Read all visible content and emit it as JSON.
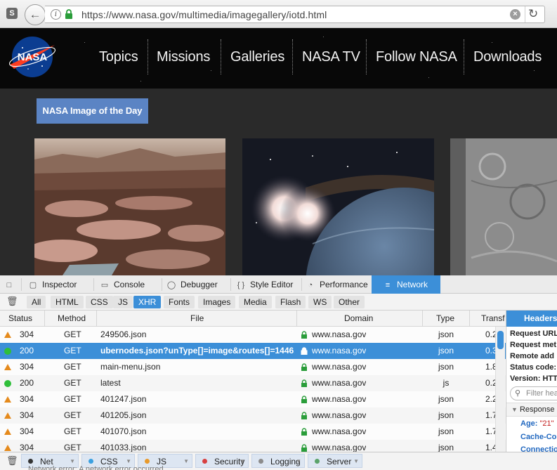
{
  "browser": {
    "ext_icon": "S",
    "url": "https://www.nasa.gov/multimedia/imagegallery/iotd.html"
  },
  "site": {
    "logo_text": "NASA",
    "nav": [
      "Topics",
      "Missions",
      "Galleries",
      "NASA TV",
      "Follow NASA",
      "Downloads"
    ],
    "badge": "NASA Image of the Day"
  },
  "devtools": {
    "tabs": [
      {
        "label": "Inspector",
        "icon": "inspector-icon"
      },
      {
        "label": "Console",
        "icon": "console-icon"
      },
      {
        "label": "Debugger",
        "icon": "debugger-icon"
      },
      {
        "label": "Style Editor",
        "icon": "style-editor-icon"
      },
      {
        "label": "Performance",
        "icon": "performance-icon"
      },
      {
        "label": "Network",
        "icon": "network-icon",
        "active": true
      }
    ],
    "filters": [
      "All",
      "HTML",
      "CSS",
      "JS",
      "XHR",
      "Fonts",
      "Images",
      "Media",
      "Flash",
      "WS",
      "Other"
    ],
    "active_filter": "XHR",
    "columns": [
      "Status",
      "Method",
      "File",
      "Domain",
      "Type",
      "Transf"
    ],
    "rows": [
      {
        "status": "304",
        "kind": "warn",
        "method": "GET",
        "file": "249506.json",
        "domain": "www.nasa.gov",
        "type": "json",
        "transf": "0.2"
      },
      {
        "status": "200",
        "kind": "ok",
        "method": "GET",
        "file": "ubernodes.json?unType[]=image&routes[]=1446...",
        "domain": "www.nasa.gov",
        "type": "json",
        "transf": "0.3",
        "selected": true
      },
      {
        "status": "304",
        "kind": "warn",
        "method": "GET",
        "file": "main-menu.json",
        "domain": "www.nasa.gov",
        "type": "json",
        "transf": "1.8"
      },
      {
        "status": "200",
        "kind": "ok",
        "method": "GET",
        "file": "latest",
        "domain": "www.nasa.gov",
        "type": "js",
        "transf": "0.2"
      },
      {
        "status": "304",
        "kind": "warn",
        "method": "GET",
        "file": "401247.json",
        "domain": "www.nasa.gov",
        "type": "json",
        "transf": "2.2"
      },
      {
        "status": "304",
        "kind": "warn",
        "method": "GET",
        "file": "401205.json",
        "domain": "www.nasa.gov",
        "type": "json",
        "transf": "1.7"
      },
      {
        "status": "304",
        "kind": "warn",
        "method": "GET",
        "file": "401070.json",
        "domain": "www.nasa.gov",
        "type": "json",
        "transf": "1.7"
      },
      {
        "status": "304",
        "kind": "warn",
        "method": "GET",
        "file": "401033.json",
        "domain": "www.nasa.gov",
        "type": "json",
        "transf": "1.4"
      }
    ],
    "side_panel": {
      "tab": "Headers",
      "lines": [
        "Request URL",
        "Request met",
        "Remote add",
        "Status code:",
        "Version: HTT"
      ],
      "filter_placeholder": "Filter hea",
      "response_label": "Response",
      "age_key": "Age:",
      "age_value": "\"21\"",
      "keys": [
        "Cache-Co",
        "Connectio"
      ]
    },
    "bottom": [
      {
        "label": "Net",
        "color": "#333333"
      },
      {
        "label": "CSS",
        "color": "#3aa0e0"
      },
      {
        "label": "JS",
        "color": "#e89a2c"
      },
      {
        "label": "Security",
        "color": "#d84040"
      },
      {
        "label": "Logging",
        "color": "#8c8c8c"
      },
      {
        "label": "Server",
        "color": "#5aa36a"
      }
    ],
    "bottom_cut": "Network error: A network error occurred"
  },
  "colors": {
    "accent": "#3c8fd8",
    "badge": "#5b84c4",
    "warn": "#e58a1c",
    "ok": "#2fbf3a"
  }
}
